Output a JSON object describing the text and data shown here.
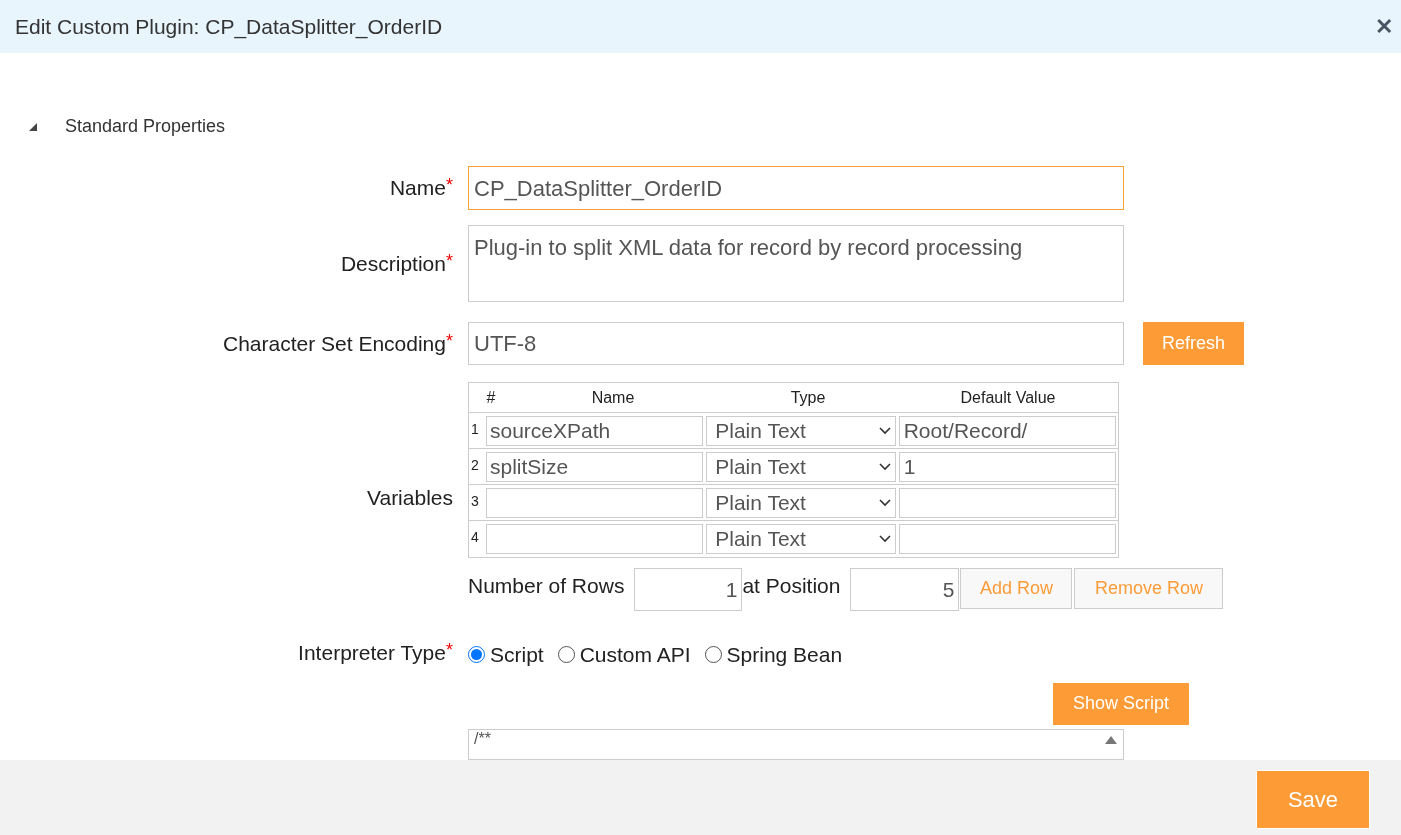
{
  "window": {
    "title": "Edit Custom Plugin: CP_DataSplitter_OrderID",
    "close": "✕"
  },
  "section": {
    "title": "Standard Properties",
    "expanded": true
  },
  "fields": {
    "name": {
      "label": "Name",
      "required": "*",
      "value": "CP_DataSplitter_OrderID",
      "focused": true
    },
    "description": {
      "label": "Description",
      "required": "*",
      "value": "Plug-in to split XML data for record by record processing"
    },
    "encoding": {
      "label": "Character Set Encoding",
      "required": "*",
      "value": "UTF-8",
      "button": "Refresh"
    }
  },
  "variables": {
    "label": "Variables",
    "columns": [
      "#",
      "Name",
      "Type",
      "Default Value"
    ],
    "rows": [
      {
        "index": "1",
        "name": "sourceXPath",
        "type": "Plain Text",
        "default": "Root/Record/"
      },
      {
        "index": "2",
        "name": "splitSize",
        "type": "Plain Text",
        "default": "1"
      },
      {
        "index": "3",
        "name": "",
        "type": "Plain Text",
        "default": ""
      },
      {
        "index": "4",
        "name": "",
        "type": "Plain Text",
        "default": ""
      }
    ],
    "rows_label": "Number of Rows",
    "rows_value": "1",
    "position_label": "at Position",
    "position_value": "5",
    "add": "Add Row",
    "remove": "Remove Row"
  },
  "interpreter": {
    "label": "Interpreter Type",
    "required": "*",
    "options": [
      {
        "label": "Script",
        "selected": true
      },
      {
        "label": "Custom API",
        "selected": false
      },
      {
        "label": "Spring Bean",
        "selected": false
      }
    ],
    "show_button": "Show Script",
    "script": "/**"
  },
  "footer": {
    "save": "Save"
  }
}
